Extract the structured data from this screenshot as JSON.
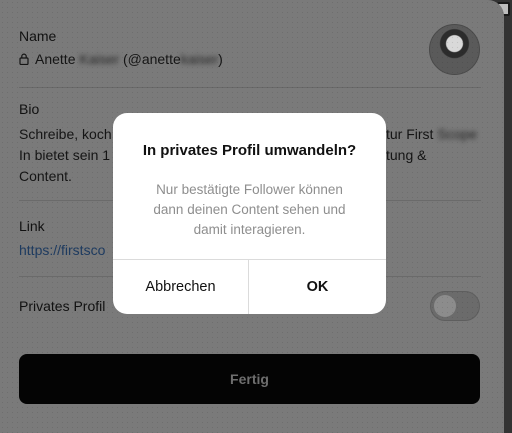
{
  "profile": {
    "name_label": "Name",
    "name_first": "Anette",
    "name_last_blurred": "Kaiser",
    "handle_open": "(@anette",
    "handle_blurred": "kaiser",
    "handle_close": ")",
    "bio_label": "Bio",
    "bio_line1_start": "Schreibe, koch",
    "bio_line1_end": "tur First",
    "bio_line1_blurred": "Scope",
    "bio_line2_start": "In bietet sein 1",
    "bio_line2_end": "tung &",
    "bio_line3": "Content.",
    "link_label": "Link",
    "link_value": "https://firstsco",
    "private_label": "Privates Profil",
    "private_enabled": false,
    "done_button": "Fertig"
  },
  "dialog": {
    "title": "In privates Profil umwandeln?",
    "message": "Nur bestätigte Follower können dann deinen Content sehen und damit interagieren.",
    "cancel_label": "Abbrechen",
    "ok_label": "OK"
  },
  "icons": {
    "lock": "lock-icon",
    "avatar": "profile-avatar",
    "window_box": "window-checkbox-icon"
  },
  "colors": {
    "overlay_sheet": "#7a7a7a",
    "dialog_bg": "#ffffff",
    "done_button_bg": "#040404"
  }
}
